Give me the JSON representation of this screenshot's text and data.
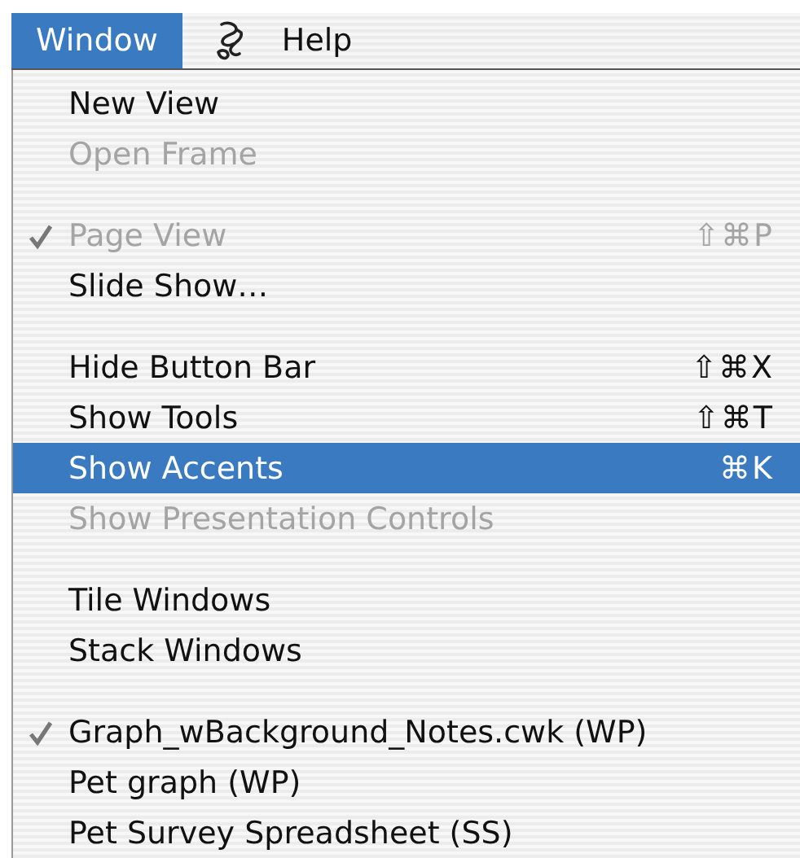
{
  "menu_bar": [
    {
      "kind": "text",
      "label": "Window",
      "selected": true
    },
    {
      "kind": "icon",
      "selected": false
    },
    {
      "kind": "text",
      "label": "Help",
      "selected": false
    }
  ],
  "menu": {
    "items": [
      {
        "kind": "item",
        "label": "New View",
        "disabled": false,
        "checked": false,
        "selected": false
      },
      {
        "kind": "item",
        "label": "Open Frame",
        "disabled": true,
        "checked": false,
        "selected": false
      },
      {
        "kind": "separator"
      },
      {
        "kind": "item",
        "label": "Page View",
        "shortcut": "⇧⌘P",
        "disabled": true,
        "checked": true,
        "selected": false
      },
      {
        "kind": "item",
        "label": "Slide Show…",
        "disabled": false,
        "checked": false,
        "selected": false
      },
      {
        "kind": "separator"
      },
      {
        "kind": "item",
        "label": "Hide Button Bar",
        "shortcut": "⇧⌘X",
        "disabled": false,
        "checked": false,
        "selected": false
      },
      {
        "kind": "item",
        "label": "Show Tools",
        "shortcut": "⇧⌘T",
        "disabled": false,
        "checked": false,
        "selected": false
      },
      {
        "kind": "item",
        "label": "Show Accents",
        "shortcut": "⌘K",
        "disabled": false,
        "checked": false,
        "selected": true
      },
      {
        "kind": "item",
        "label": "Show Presentation Controls",
        "disabled": true,
        "checked": false,
        "selected": false
      },
      {
        "kind": "separator"
      },
      {
        "kind": "item",
        "label": "Tile Windows",
        "disabled": false,
        "checked": false,
        "selected": false
      },
      {
        "kind": "item",
        "label": "Stack Windows",
        "disabled": false,
        "checked": false,
        "selected": false
      },
      {
        "kind": "separator"
      },
      {
        "kind": "item",
        "label": "Graph_wBackground_Notes.cwk (WP)",
        "disabled": false,
        "checked": true,
        "selected": false
      },
      {
        "kind": "item",
        "label": "Pet graph (WP)",
        "disabled": false,
        "checked": false,
        "selected": false
      },
      {
        "kind": "item",
        "label": "Pet Survey Spreadsheet (SS)",
        "disabled": false,
        "checked": false,
        "selected": false
      }
    ]
  }
}
